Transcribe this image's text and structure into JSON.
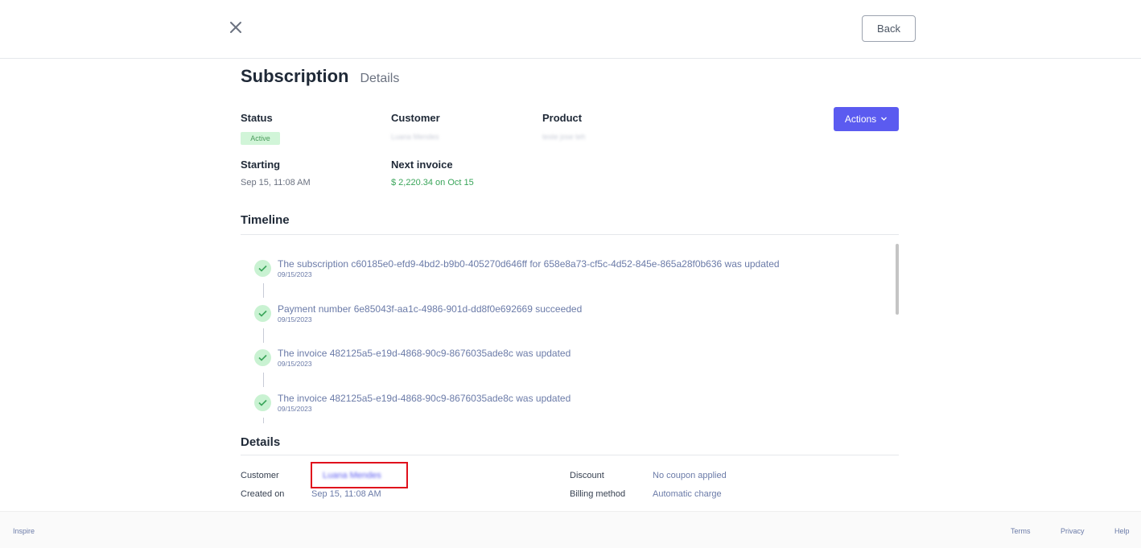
{
  "header": {
    "back_label": "Back"
  },
  "title": {
    "main": "Subscription",
    "sub": "Details"
  },
  "summary": {
    "status_label": "Status",
    "status_value": "Active",
    "customer_label": "Customer",
    "customer_value": "Luana Mendes",
    "product_label": "Product",
    "product_value": "teste jose teh",
    "starting_label": "Starting",
    "starting_value": "Sep 15, 11:08 AM",
    "next_invoice_label": "Next invoice",
    "next_invoice_value": "$ 2,220.34 on Oct 15"
  },
  "actions": {
    "label": "Actions"
  },
  "timeline": {
    "title": "Timeline",
    "items": [
      {
        "text": "The subscription c60185e0-efd9-4bd2-b9b0-405270d646ff for 658e8a73-cf5c-4d52-845e-865a28f0b636 was updated",
        "date": "09/15/2023"
      },
      {
        "text": "Payment number 6e85043f-aa1c-4986-901d-dd8f0e692669 succeeded",
        "date": "09/15/2023"
      },
      {
        "text": "The invoice 482125a5-e19d-4868-90c9-8676035ade8c was updated",
        "date": "09/15/2023"
      },
      {
        "text": "The invoice 482125a5-e19d-4868-90c9-8676035ade8c was updated",
        "date": "09/15/2023"
      }
    ]
  },
  "details": {
    "title": "Details",
    "customer_label": "Customer",
    "customer_value": "Luana Mendes",
    "created_label": "Created on",
    "created_value": "Sep 15, 11:08 AM",
    "discount_label": "Discount",
    "discount_value": "No coupon applied",
    "billing_label": "Billing method",
    "billing_value": "Automatic charge"
  },
  "footer": {
    "brand": "Inspire",
    "terms": "Terms",
    "privacy": "Privacy",
    "help": "Help"
  },
  "colors": {
    "accent": "#5b5bf0",
    "success": "#3aa55a",
    "highlight": "#e0101c"
  }
}
